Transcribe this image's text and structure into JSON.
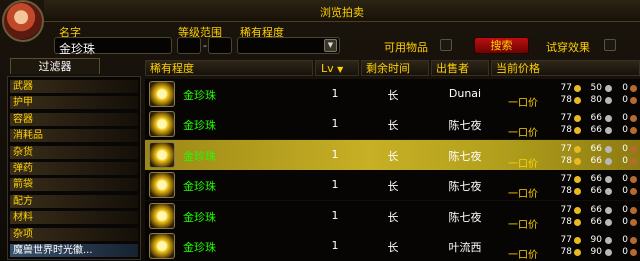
{
  "window": {
    "title": "浏览拍卖"
  },
  "search": {
    "name_label": "名字",
    "name_value": "金珍珠",
    "level_label": "等级范围",
    "level_dash": "-",
    "rarity_label": "稀有程度",
    "usable_label": "可用物品",
    "search_button": "搜索",
    "tryon_label": "试穿效果"
  },
  "filters": {
    "tab_label": "过滤器",
    "items": [
      "武器",
      "护甲",
      "容器",
      "消耗品",
      "杂货",
      "弹药",
      "箭袋",
      "配方",
      "材料",
      "杂项",
      "魔兽世界时光徽..."
    ],
    "selected_index": 10
  },
  "columns": {
    "rarity": "稀有程度",
    "level": "Lv",
    "sort_indicator": "▼",
    "time": "剩余时间",
    "seller": "出售者",
    "price": "当前价格"
  },
  "buyout_label": "一口价",
  "listings": [
    {
      "name": "金珍珠",
      "level": "1",
      "time": "长",
      "seller": "Dunai",
      "bid": {
        "g": "77",
        "s": "50",
        "c": "0"
      },
      "buyout": {
        "g": "78",
        "s": "80",
        "c": "0"
      },
      "highlighted": false
    },
    {
      "name": "金珍珠",
      "level": "1",
      "time": "长",
      "seller": "陈七夜",
      "bid": {
        "g": "77",
        "s": "66",
        "c": "0"
      },
      "buyout": {
        "g": "78",
        "s": "66",
        "c": "0"
      },
      "highlighted": false
    },
    {
      "name": "金珍珠",
      "level": "1",
      "time": "长",
      "seller": "陈七夜",
      "bid": {
        "g": "77",
        "s": "66",
        "c": "0"
      },
      "buyout": {
        "g": "78",
        "s": "66",
        "c": "0"
      },
      "highlighted": true
    },
    {
      "name": "金珍珠",
      "level": "1",
      "time": "长",
      "seller": "陈七夜",
      "bid": {
        "g": "77",
        "s": "66",
        "c": "0"
      },
      "buyout": {
        "g": "78",
        "s": "66",
        "c": "0"
      },
      "highlighted": false
    },
    {
      "name": "金珍珠",
      "level": "1",
      "time": "长",
      "seller": "陈七夜",
      "bid": {
        "g": "77",
        "s": "66",
        "c": "0"
      },
      "buyout": {
        "g": "78",
        "s": "66",
        "c": "0"
      },
      "highlighted": false
    },
    {
      "name": "金珍珠",
      "level": "1",
      "time": "长",
      "seller": "叶流西",
      "bid": {
        "g": "77",
        "s": "90",
        "c": "0"
      },
      "buyout": {
        "g": "78",
        "s": "90",
        "c": "0"
      },
      "highlighted": false
    }
  ],
  "icons": {
    "item": "gold-pearl-icon",
    "portrait": "character-portrait",
    "gold": "gold-coin-icon",
    "silver": "silver-coin-icon",
    "copper": "copper-coin-icon"
  },
  "colors": {
    "title": "#ffd100",
    "uncommon": "#1eff00",
    "search_button": "#a80a0a",
    "row_highlight": "#c7b025"
  }
}
